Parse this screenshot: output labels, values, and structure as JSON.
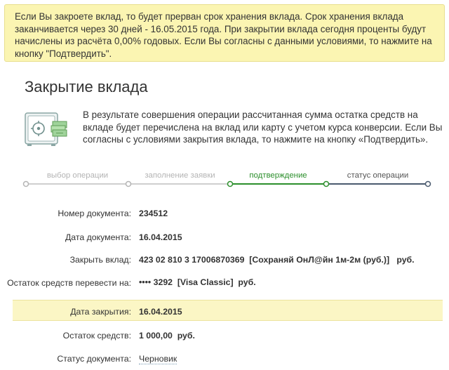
{
  "warning": {
    "text": "Если Вы закроете вклад, то будет прерван срок хранения вклада. Срок хранения вклада заканчивается через 30 дней - 16.05.2015 года. При закрытии вклада сегодня проценты будут начислены из расчёта 0,00% годовых. Если Вы согласны с данными условиями, то нажмите на кнопку \"Подтвердить\"."
  },
  "page": {
    "title": "Закрытие вклада",
    "info": "В результате совершения операции рассчитанная сумма остатка средств на вкладе будет перечислена на вклад или карту с учетом курса конверсии. Если Вы согласны с условиями закрытия вклада, то нажмите на кнопку «Подтвердить».",
    "icon": "safe-icon"
  },
  "steps": [
    {
      "label": "выбор операции",
      "state": "done"
    },
    {
      "label": "заполнение заявки",
      "state": "done"
    },
    {
      "label": "подтверждение",
      "state": "active"
    },
    {
      "label": "статус операции",
      "state": "future"
    }
  ],
  "colors": {
    "warning_bg": "#fbf5b2",
    "active_step": "#2c8f2c",
    "future_step": "#4a5a6e",
    "done_step": "#c8c8c8",
    "link": "#5a84a2"
  },
  "fields": {
    "doc_number": {
      "label": "Номер документа:",
      "value": "234512"
    },
    "doc_date": {
      "label": "Дата документа:",
      "value": "16.04.2015"
    },
    "close_deposit": {
      "label": "Закрыть вклад:",
      "value": "423 02 810 3 17006870369  [Сохраняй ОнЛ@йн 1м-2м (руб.)]   руб."
    },
    "transfer_to": {
      "label": "Остаток средств перевести на:",
      "value": "•••• 3292  [Visa Classic]  руб."
    },
    "close_date": {
      "label": "Дата закрытия:",
      "value": "16.04.2015"
    },
    "balance": {
      "label": "Остаток средств:",
      "value": "1 000,00  руб."
    },
    "status": {
      "label": "Статус документа:",
      "value": "Черновик"
    }
  }
}
